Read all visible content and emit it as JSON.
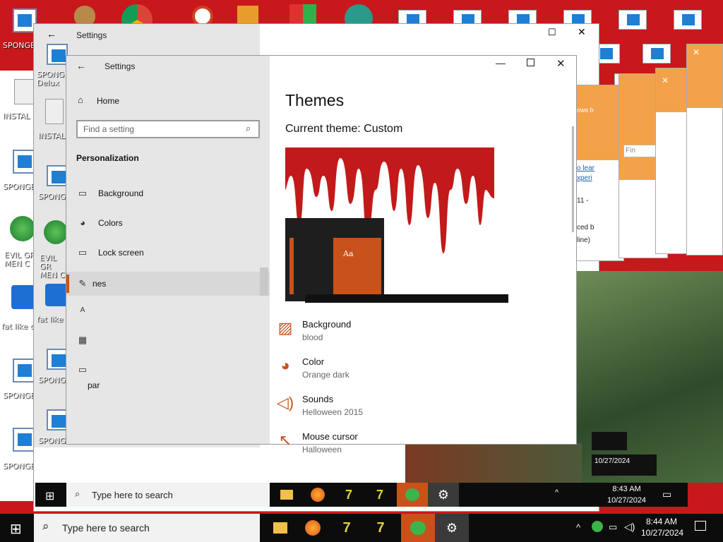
{
  "desktop": {
    "icons": [
      {
        "label": "SPONGE Delux"
      },
      {
        "label": "INSTAL"
      },
      {
        "label": "SPONGE"
      },
      {
        "label": "EVIL GR MEN C"
      },
      {
        "label": "fat like d"
      },
      {
        "label": "SPONGE"
      },
      {
        "label": "SPONGE"
      }
    ],
    "back_icons": [
      {
        "label": "SPONGE Delux"
      },
      {
        "label": "INSTAL"
      },
      {
        "label": "SPONGE"
      },
      {
        "label": "EVIL GR MEN C"
      },
      {
        "label": "fat like d"
      },
      {
        "label": "SPONGE"
      },
      {
        "label": "SPONGE"
      }
    ]
  },
  "back_window": {
    "title": "Settings"
  },
  "settings": {
    "title": "Settings",
    "home": "Home",
    "search_placeholder": "Find a setting",
    "section": "Personalization",
    "nav": [
      {
        "label": "Background",
        "icon": "picture-icon"
      },
      {
        "label": "Colors",
        "icon": "palette-icon"
      },
      {
        "label": "Lock screen",
        "icon": "lock-screen-icon"
      },
      {
        "label": "nes",
        "icon": "themes-icon"
      },
      {
        "label": "",
        "icon": "fonts-icon"
      },
      {
        "label": "",
        "icon": "start-icon"
      },
      {
        "label": "par",
        "icon": "taskbar-icon"
      }
    ],
    "heading": "Themes",
    "current_theme": "Current theme: Custom",
    "preview_tile_text": "Aa",
    "options": [
      {
        "title": "Background",
        "value": "blood",
        "icon": "picture-icon"
      },
      {
        "title": "Color",
        "value": "Orange dark",
        "icon": "palette-icon"
      },
      {
        "title": "Sounds",
        "value": "Helloween 2015",
        "icon": "speaker-icon"
      },
      {
        "title": "Mouse cursor",
        "value": "Halloween",
        "icon": "cursor-icon"
      }
    ]
  },
  "orange_windows": {
    "link1": "o lear",
    "link2": "xperi",
    "text1": "11 -",
    "text2": "ced b",
    "text3": "line)",
    "find": "Fin"
  },
  "taskbar_front": {
    "search": "Type here to search",
    "time": "8:44 AM",
    "date": "10/27/2024"
  },
  "taskbar_back": {
    "search": "Type here to search",
    "time": "8:43 AM",
    "date": "10/27/2024"
  },
  "mini_clocks": [
    {
      "time": "",
      "date": "10/27/2024"
    }
  ],
  "colors": {
    "accent": "#c8521a",
    "desktop": "#c8181c"
  }
}
